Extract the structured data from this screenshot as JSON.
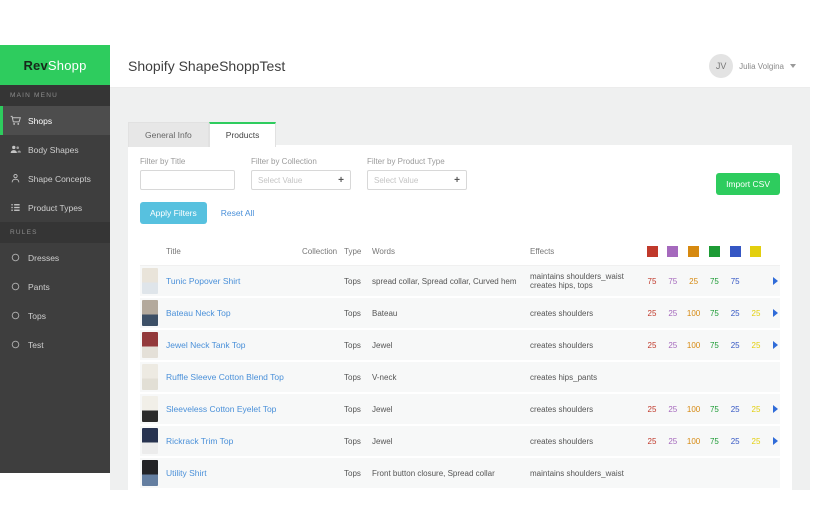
{
  "sidebar": {
    "logo": {
      "bold": "Rev",
      "rest": "Shopp"
    },
    "sections": [
      {
        "label": "Main Menu",
        "items": [
          {
            "label": "Shops",
            "icon": "cart-icon",
            "active": true
          },
          {
            "label": "Body Shapes",
            "icon": "users-icon",
            "active": false
          },
          {
            "label": "Shape Concepts",
            "icon": "person-icon",
            "active": false
          },
          {
            "label": "Product Types",
            "icon": "list-icon",
            "active": false
          }
        ]
      },
      {
        "label": "Rules",
        "items": [
          {
            "label": "Dresses",
            "icon": "circle-icon",
            "active": false
          },
          {
            "label": "Pants",
            "icon": "circle-icon",
            "active": false
          },
          {
            "label": "Tops",
            "icon": "circle-icon",
            "active": false
          },
          {
            "label": "Test",
            "icon": "circle-icon",
            "active": false
          }
        ]
      }
    ]
  },
  "header": {
    "title": "Shopify ShapeShoppTest",
    "avatar_initials": "JV",
    "user_name": "Julia Volgina"
  },
  "tabs": [
    {
      "label": "General Info",
      "active": false
    },
    {
      "label": "Products",
      "active": true
    }
  ],
  "filters": {
    "title": {
      "label": "Filter by Title",
      "value": ""
    },
    "collection": {
      "label": "Filter by Collection",
      "placeholder": "Select Value"
    },
    "product_type": {
      "label": "Filter by Product Type",
      "placeholder": "Select Value"
    },
    "apply_label": "Apply Filters",
    "reset_label": "Reset All",
    "import_label": "Import CSV"
  },
  "accent": {
    "green": "#2ecc5e",
    "teal": "#57c1df",
    "link_blue": "#4a90d9",
    "arrow_blue": "#2f6bd8"
  },
  "table": {
    "columns": {
      "title": "Title",
      "collection": "Collection",
      "type": "Type",
      "words": "Words",
      "effects": "Effects"
    },
    "score_colors": [
      "#c0392b",
      "#a569bd",
      "#d68910",
      "#1d9b35",
      "#3557c4",
      "#e3cf0e"
    ],
    "rows": [
      {
        "title": "Tunic Popover Shirt",
        "collection": "",
        "type": "Tops",
        "words": "spread collar, Spread collar, Curved hem",
        "effects": "maintains shoulders_waist creates hips, tops",
        "scores": [
          "75",
          "75",
          "25",
          "75",
          "75",
          ""
        ],
        "arrow": true,
        "thumb": [
          "#e9e4da",
          "#dfe5ea"
        ]
      },
      {
        "title": "Bateau Neck Top",
        "collection": "",
        "type": "Tops",
        "words": "Bateau",
        "effects": "creates shoulders",
        "scores": [
          "25",
          "25",
          "100",
          "75",
          "25",
          "25"
        ],
        "arrow": true,
        "thumb": [
          "#b3a99c",
          "#3c4f66"
        ]
      },
      {
        "title": "Jewel Neck Tank Top",
        "collection": "",
        "type": "Tops",
        "words": "Jewel",
        "effects": "creates shoulders",
        "scores": [
          "25",
          "25",
          "100",
          "75",
          "25",
          "25"
        ],
        "arrow": true,
        "thumb": [
          "#93393b",
          "#e4e0d8"
        ]
      },
      {
        "title": "Ruffle Sleeve Cotton Blend Top",
        "collection": "",
        "type": "Tops",
        "words": "V-neck",
        "effects": "creates hips_pants",
        "scores": [
          "",
          "",
          "",
          "",
          "",
          ""
        ],
        "arrow": false,
        "thumb": [
          "#edeae2",
          "#e2dfd5"
        ]
      },
      {
        "title": "Sleeveless Cotton Eyelet Top",
        "collection": "",
        "type": "Tops",
        "words": "Jewel",
        "effects": "creates shoulders",
        "scores": [
          "25",
          "25",
          "100",
          "75",
          "25",
          "25"
        ],
        "arrow": true,
        "thumb": [
          "#f1efe8",
          "#2b2b2b"
        ]
      },
      {
        "title": "Rickrack Trim Top",
        "collection": "",
        "type": "Tops",
        "words": "Jewel",
        "effects": "creates shoulders",
        "scores": [
          "25",
          "25",
          "100",
          "75",
          "25",
          "25"
        ],
        "arrow": true,
        "thumb": [
          "#273350",
          "#ececec"
        ]
      },
      {
        "title": "Utility Shirt",
        "collection": "",
        "type": "Tops",
        "words": "Front button closure, Spread collar",
        "effects": "maintains shoulders_waist",
        "scores": [
          "",
          "",
          "",
          "",
          "",
          ""
        ],
        "arrow": false,
        "thumb": [
          "#232326",
          "#647ea0"
        ]
      }
    ]
  }
}
